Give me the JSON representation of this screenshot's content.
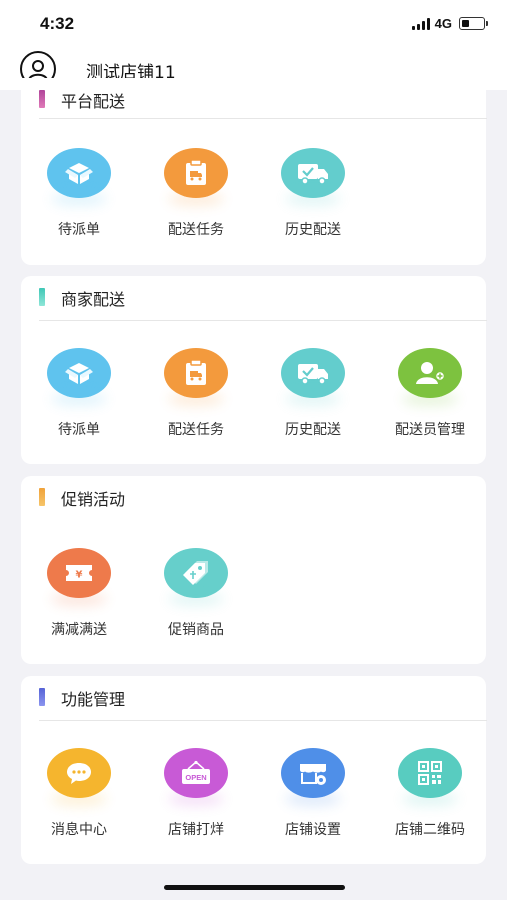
{
  "status_bar": {
    "time": "4:32",
    "network": "4G"
  },
  "header": {
    "title": "测试店铺11",
    "avatar_icon": "user-avatar-icon"
  },
  "sections": {
    "platform": {
      "title": "平台配送",
      "accent": "#b0459a",
      "items": [
        {
          "label": "待派单",
          "icon": "box-icon",
          "color": "#5fc3ee"
        },
        {
          "label": "配送任务",
          "icon": "clipboard-truck-icon",
          "color": "#f39a3d"
        },
        {
          "label": "历史配送",
          "icon": "truck-check-icon",
          "color": "#63cdcd"
        }
      ]
    },
    "merchant": {
      "title": "商家配送",
      "accent": "#3fc7b6",
      "items": [
        {
          "label": "待派单",
          "icon": "box-icon",
          "color": "#5fc3ee"
        },
        {
          "label": "配送任务",
          "icon": "clipboard-truck-icon",
          "color": "#f39a3d"
        },
        {
          "label": "历史配送",
          "icon": "truck-check-icon",
          "color": "#63cdcd"
        },
        {
          "label": "配送员管理",
          "icon": "courier-manage-icon",
          "color": "#7dc23f"
        }
      ]
    },
    "promotion": {
      "title": "促销活动",
      "accent": "#f0a23a",
      "items": [
        {
          "label": "满减满送",
          "icon": "coupon-icon",
          "color": "#ee7a4b"
        },
        {
          "label": "促销商品",
          "icon": "tag-icon",
          "color": "#66cfcb"
        }
      ]
    },
    "function": {
      "title": "功能管理",
      "accent": "#5663d6",
      "items": [
        {
          "label": "消息中心",
          "icon": "message-icon",
          "color": "#f5b52e"
        },
        {
          "label": "店铺打烊",
          "icon": "open-sign-icon",
          "color": "#c85ad6",
          "sign_text": "OPEN"
        },
        {
          "label": "店铺设置",
          "icon": "shop-settings-icon",
          "color": "#4f8fe8"
        },
        {
          "label": "店铺二维码",
          "icon": "qr-code-icon",
          "color": "#58ccc0"
        }
      ]
    }
  }
}
